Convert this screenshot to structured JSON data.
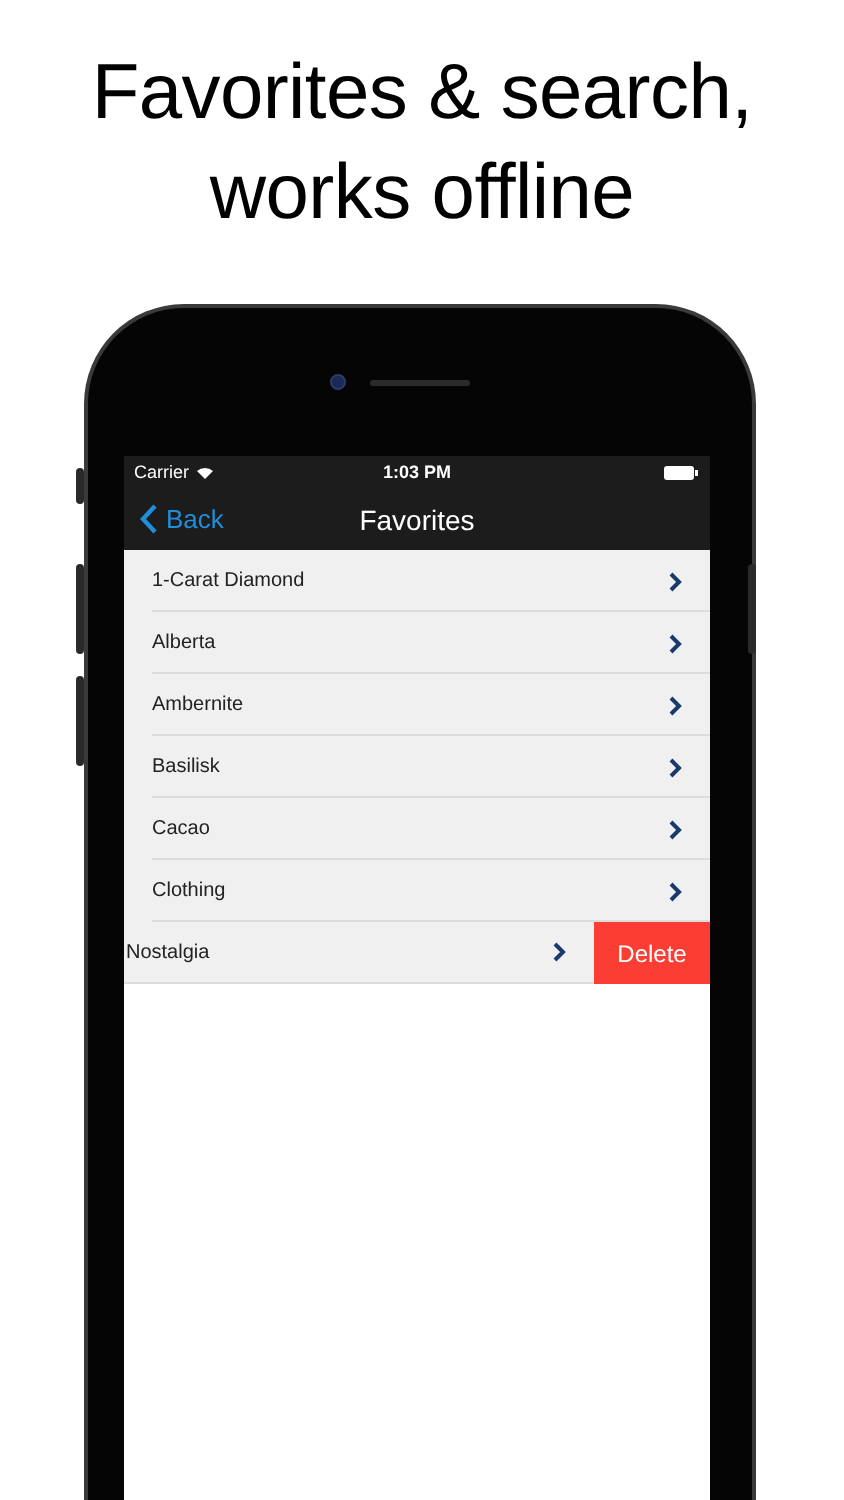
{
  "headline": [
    "Favorites & search,",
    "works offline"
  ],
  "status_bar": {
    "carrier": "Carrier",
    "time": "1:03 PM"
  },
  "nav_bar": {
    "back": "Back",
    "title": "Favorites"
  },
  "rows": [
    {
      "label": "1-Carat Diamond",
      "swiped": false
    },
    {
      "label": "Alberta",
      "swiped": false
    },
    {
      "label": "Ambernite",
      "swiped": false
    },
    {
      "label": "Basilisk",
      "swiped": false
    },
    {
      "label": "Cacao",
      "swiped": false
    },
    {
      "label": "Clothing",
      "swiped": false
    },
    {
      "label": "Nostalgia",
      "swiped": true
    }
  ],
  "delete_label": "Delete"
}
